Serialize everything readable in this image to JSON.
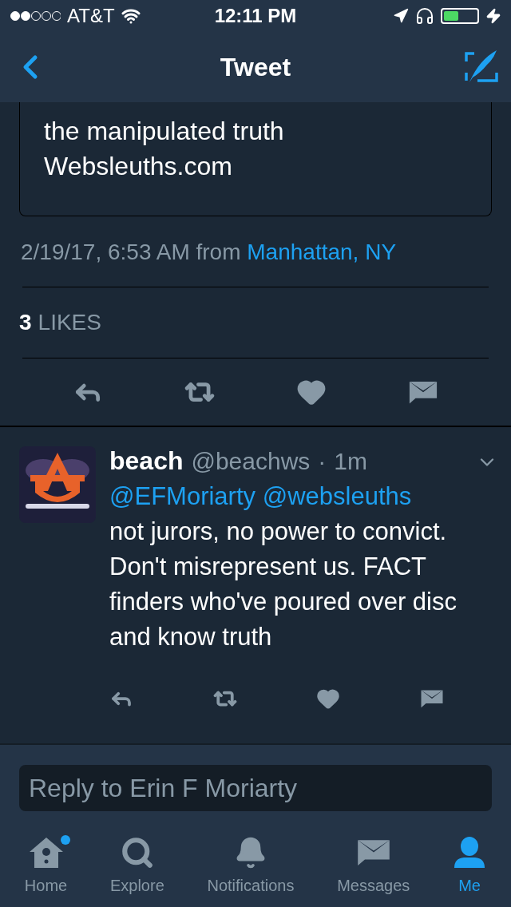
{
  "status_bar": {
    "carrier": "AT&T",
    "time": "12:11 PM"
  },
  "nav": {
    "title": "Tweet"
  },
  "tweet": {
    "text_lines": [
      "the manipulated truth",
      "Websleuths.com"
    ],
    "timestamp": "2/19/17, 6:53 AM from",
    "location": "Manhattan, NY",
    "likes_count": "3",
    "likes_label": "LIKES",
    "liked": false
  },
  "reply": {
    "name": "beach",
    "handle": "@beachws",
    "separator": "·",
    "time": "1m",
    "mentions": [
      "@EFMoriarty",
      "@websleuths"
    ],
    "text": "not jurors, no power to convict. Don't misrepresent us. FACT finders who've poured over disc and know truth",
    "liked": false
  },
  "reply_field": {
    "placeholder": "Reply to Erin F Moriarty"
  },
  "tabs": [
    {
      "kind": "home",
      "label": "Home",
      "selected": false,
      "badge": true
    },
    {
      "kind": "explore",
      "label": "Explore",
      "selected": false,
      "badge": false
    },
    {
      "kind": "notifications",
      "label": "Notifications",
      "selected": false,
      "badge": false
    },
    {
      "kind": "messages",
      "label": "Messages",
      "selected": false,
      "badge": false
    },
    {
      "kind": "me",
      "label": "Me",
      "selected": true,
      "badge": false
    }
  ]
}
